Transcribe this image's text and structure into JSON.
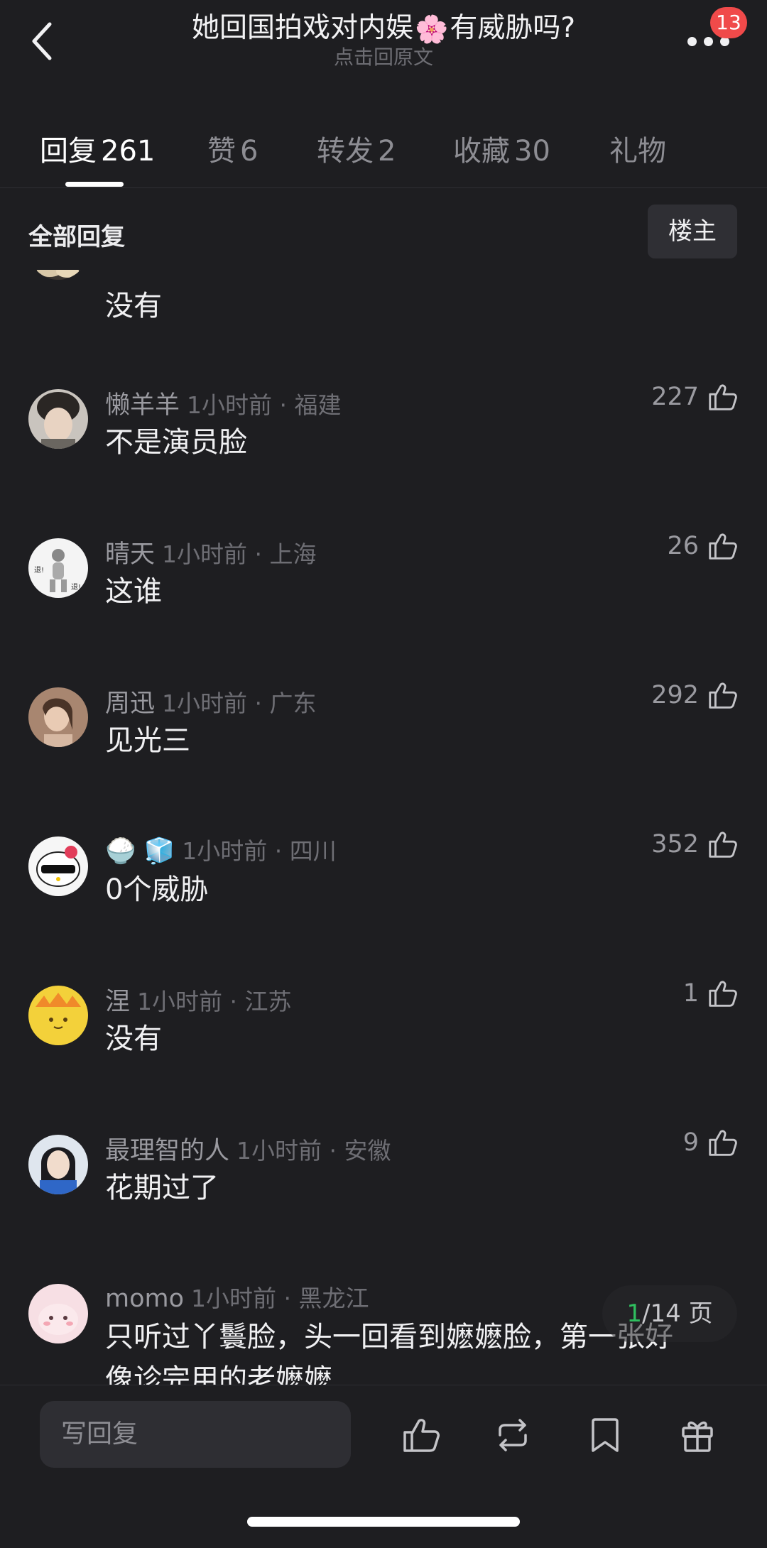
{
  "header": {
    "title_before": "她回国拍戏对内娱",
    "title_emoji": "🌸",
    "title_after": "有威胁吗?",
    "subtitle": "点击回原文",
    "notification_count": "13"
  },
  "tabs": [
    {
      "label": "回复",
      "count": "261"
    },
    {
      "label": "赞",
      "count": "6"
    },
    {
      "label": "转发",
      "count": "2"
    },
    {
      "label": "收藏",
      "count": "30"
    },
    {
      "label": "礼物",
      "count": ""
    }
  ],
  "filter": {
    "label": "全部回复",
    "owner_button": "楼主"
  },
  "comments": [
    {
      "user": "",
      "time": "",
      "text": "没有",
      "likes": ""
    },
    {
      "user": "懒羊羊",
      "time": "1小时前 · 福建",
      "text": "不是演员脸",
      "likes": "227"
    },
    {
      "user": "晴天",
      "time": "1小时前 · 上海",
      "text": "这谁",
      "likes": "26"
    },
    {
      "user": "周迅",
      "time": "1小时前 · 广东",
      "text": "见光三",
      "likes": "292"
    },
    {
      "user": "🍚 🧊",
      "time": "1小时前 · 四川",
      "text": "0个威胁",
      "likes": "352"
    },
    {
      "user": "涅",
      "time": "1小时前 · 江苏",
      "text": "没有",
      "likes": "1"
    },
    {
      "user": "最理智的人",
      "time": "1小时前 · 安徽",
      "text": "花期过了",
      "likes": "9"
    },
    {
      "user": "momo",
      "time": "1小时前 · 黑龙江",
      "text": "只听过丫鬟脸，头一回看到嬷嬷脸，第一张好",
      "text2": "像诊完用的老嬷嬷",
      "likes": ""
    }
  ],
  "pager": {
    "current": "1",
    "total_text": "/14 页"
  },
  "bottom": {
    "reply_placeholder": "写回复",
    "icons": [
      "thumbs-up-icon",
      "repost-icon",
      "bookmark-icon",
      "gift-icon"
    ]
  },
  "colors": {
    "background": "#1e1e21",
    "badge": "#f04a4a",
    "pager_current": "#2fbf5f"
  }
}
